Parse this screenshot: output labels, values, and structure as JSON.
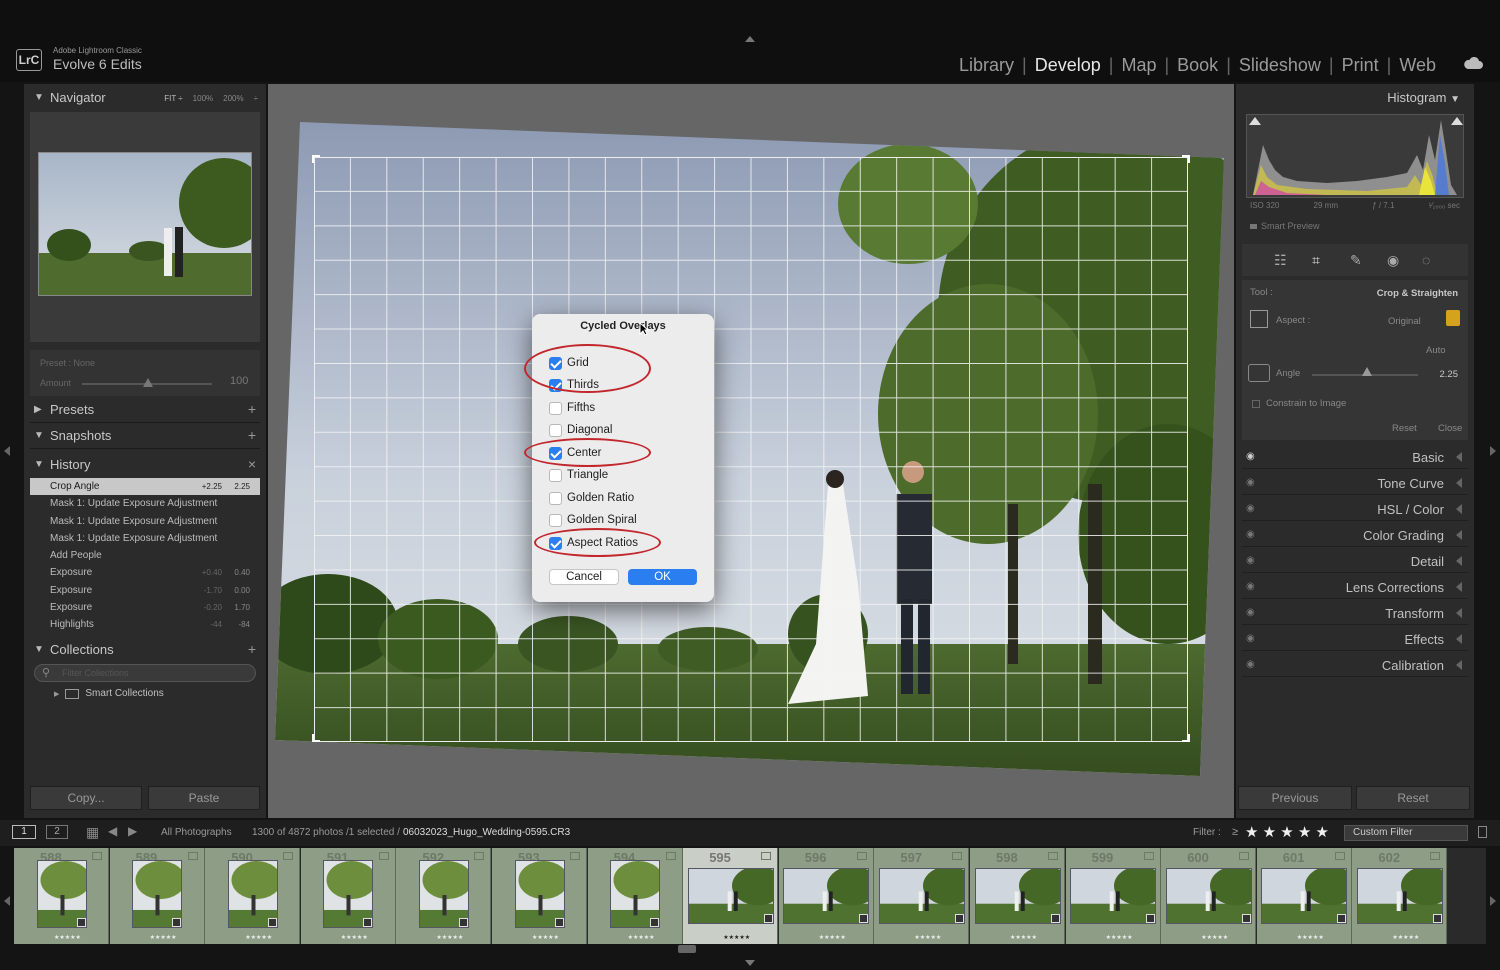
{
  "app": {
    "logo": "LrC",
    "name": "Adobe Lightroom Classic",
    "catalog": "Evolve 6 Edits",
    "modules": [
      "Library",
      "Develop",
      "Map",
      "Book",
      "Slideshow",
      "Print",
      "Web"
    ],
    "active_module": "Develop"
  },
  "left": {
    "navigator": {
      "title": "Navigator",
      "zoom": [
        "FIT ÷",
        "100%",
        "200%",
        "÷"
      ]
    },
    "preset": {
      "label": "Preset : None",
      "amount_label": "Amount",
      "amount_value": "100",
      "amount_fraction": 0.5
    },
    "presets_title": "Presets",
    "snapshots_title": "Snapshots",
    "history": {
      "title": "History",
      "close": "×",
      "rows": [
        {
          "label": "Crop Angle",
          "v1": "+2.25",
          "v2": "2.25",
          "selected": true
        },
        {
          "label": "Mask 1: Update Exposure Adjustment",
          "v1": "",
          "v2": ""
        },
        {
          "label": "Mask 1: Update Exposure Adjustment",
          "v1": "",
          "v2": ""
        },
        {
          "label": "Mask 1: Update Exposure Adjustment",
          "v1": "",
          "v2": ""
        },
        {
          "label": "Add People",
          "v1": "",
          "v2": ""
        },
        {
          "label": "Exposure",
          "v1": "+0.40",
          "v2": "0.40"
        },
        {
          "label": "Exposure",
          "v1": "-1.70",
          "v2": "0.00"
        },
        {
          "label": "Exposure",
          "v1": "-0.20",
          "v2": "1.70"
        },
        {
          "label": "Highlights",
          "v1": "-44",
          "v2": "-84"
        }
      ]
    },
    "collections": {
      "title": "Collections",
      "filter_placeholder": "Filter Collections",
      "smart": "Smart Collections"
    },
    "copy_label": "Copy...",
    "paste_label": "Paste"
  },
  "dialog": {
    "title": "Cycled Overlays",
    "options": [
      {
        "label": "Grid",
        "checked": true
      },
      {
        "label": "Thirds",
        "checked": true
      },
      {
        "label": "Fifths",
        "checked": false
      },
      {
        "label": "Diagonal",
        "checked": false
      },
      {
        "label": "Center",
        "checked": true
      },
      {
        "label": "Triangle",
        "checked": false
      },
      {
        "label": "Golden Ratio",
        "checked": false
      },
      {
        "label": "Golden Spiral",
        "checked": false
      },
      {
        "label": "Aspect Ratios",
        "checked": true
      }
    ],
    "cancel": "Cancel",
    "ok": "OK"
  },
  "right": {
    "histogram_title": "Histogram",
    "exif": [
      "ISO 320",
      "29 mm",
      "ƒ / 7.1",
      "¹⁄₁₀₀₀ sec"
    ],
    "smart_preview": "Smart Preview",
    "tool_label": "Tool :",
    "tool_name": "Crop & Straighten",
    "aspect_label": "Aspect :",
    "aspect_value": "Original",
    "auto": "Auto",
    "angle_label": "Angle",
    "angle_value": "2.25",
    "constrain": "Constrain to Image",
    "reset": "Reset",
    "close": "Close",
    "sections": [
      "Basic",
      "Tone Curve",
      "HSL / Color",
      "Color Grading",
      "Detail",
      "Lens Corrections",
      "Transform",
      "Effects",
      "Calibration"
    ],
    "previous": "Previous",
    "reset_btn": "Reset"
  },
  "filmstrip": {
    "page1": "1",
    "page2": "2",
    "source": "All Photographs",
    "count": "1300 of 4872 photos /1 selected /",
    "filename": "06032023_Hugo_Wedding-0595.CR3",
    "filter_label": "Filter :",
    "filter_op": "≥",
    "stars": "★ ★ ★ ★ ★",
    "custom_filter": "Custom Filter",
    "frames": [
      "588",
      "589",
      "590",
      "591",
      "592",
      "593",
      "594",
      "595",
      "596",
      "597",
      "598",
      "599",
      "600",
      "601",
      "602"
    ],
    "selected": "595",
    "rating": "★★★★★"
  },
  "colors": {
    "accent": "#2a7ef0",
    "annotation": "#c1272d",
    "film_bg": "#8d9d86"
  }
}
